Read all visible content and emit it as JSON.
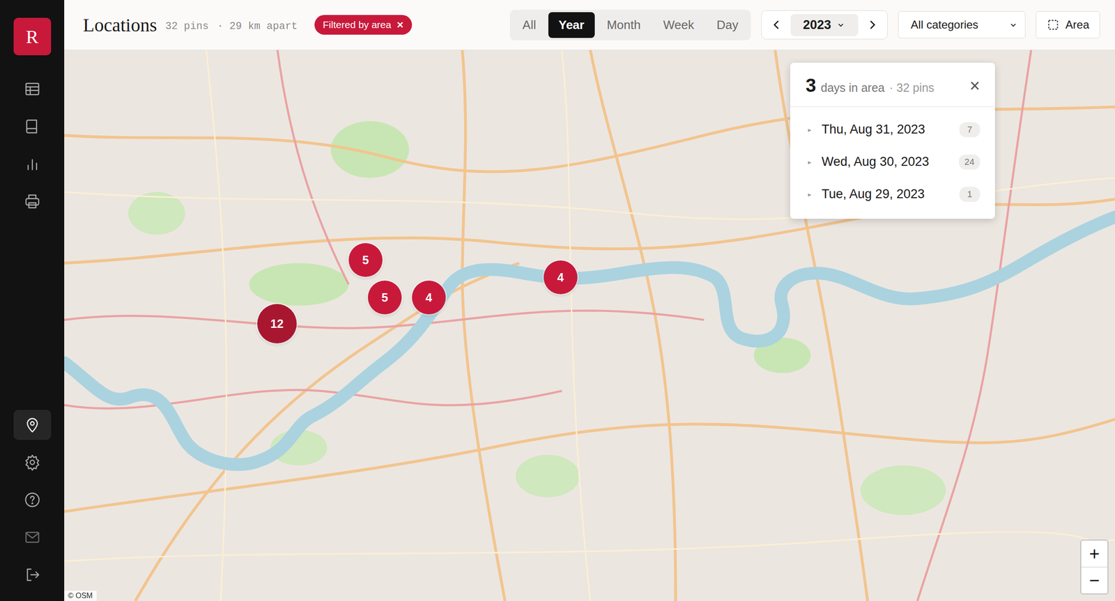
{
  "sidebar": {
    "logo": "R",
    "top_items": [
      {
        "kind": "table",
        "selected": false,
        "disabled": false
      },
      {
        "kind": "book",
        "selected": false,
        "disabled": false
      },
      {
        "kind": "chart",
        "selected": false,
        "disabled": false
      },
      {
        "kind": "printer",
        "selected": false,
        "disabled": false
      }
    ],
    "bottom_items": [
      {
        "kind": "pin",
        "selected": true,
        "disabled": false
      },
      {
        "kind": "gear",
        "selected": false,
        "disabled": false
      },
      {
        "kind": "help",
        "selected": false,
        "disabled": false
      },
      {
        "kind": "mail",
        "selected": false,
        "disabled": true
      },
      {
        "kind": "logout",
        "selected": false,
        "disabled": false
      }
    ]
  },
  "header": {
    "title": "Locations",
    "pin_count": "32 pins",
    "distance": "· 29 km apart",
    "filter_chip": {
      "label": "Filtered by area",
      "close": "×"
    }
  },
  "range_tabs": [
    {
      "label": "All",
      "selected": false
    },
    {
      "label": "Year",
      "selected": true
    },
    {
      "label": "Month",
      "selected": false
    },
    {
      "label": "Week",
      "selected": false
    },
    {
      "label": "Day",
      "selected": false
    }
  ],
  "year_nav": {
    "year": "2023"
  },
  "category_select": {
    "value": "All categories"
  },
  "area_button": {
    "label": "Area"
  },
  "pins": [
    {
      "count": "5"
    },
    {
      "count": "5"
    },
    {
      "count": "4"
    },
    {
      "count": "4"
    },
    {
      "count": "12"
    }
  ],
  "area_panel": {
    "count": "3",
    "label": "days in area",
    "pins": "· 32 pins",
    "close": "×",
    "days": [
      {
        "marker": "▸",
        "date": "Thu, Aug 31, 2023",
        "count": "7",
        "expanded": false
      },
      {
        "marker": "▸",
        "date": "Wed, Aug 30, 2023",
        "count": "24",
        "expanded": false
      },
      {
        "marker": "▸",
        "date": "Tue, Aug 29, 2023",
        "count": "1",
        "expanded": false
      }
    ]
  },
  "zoom": {
    "in": "+",
    "out": "−"
  },
  "attribution": "© OSM"
}
